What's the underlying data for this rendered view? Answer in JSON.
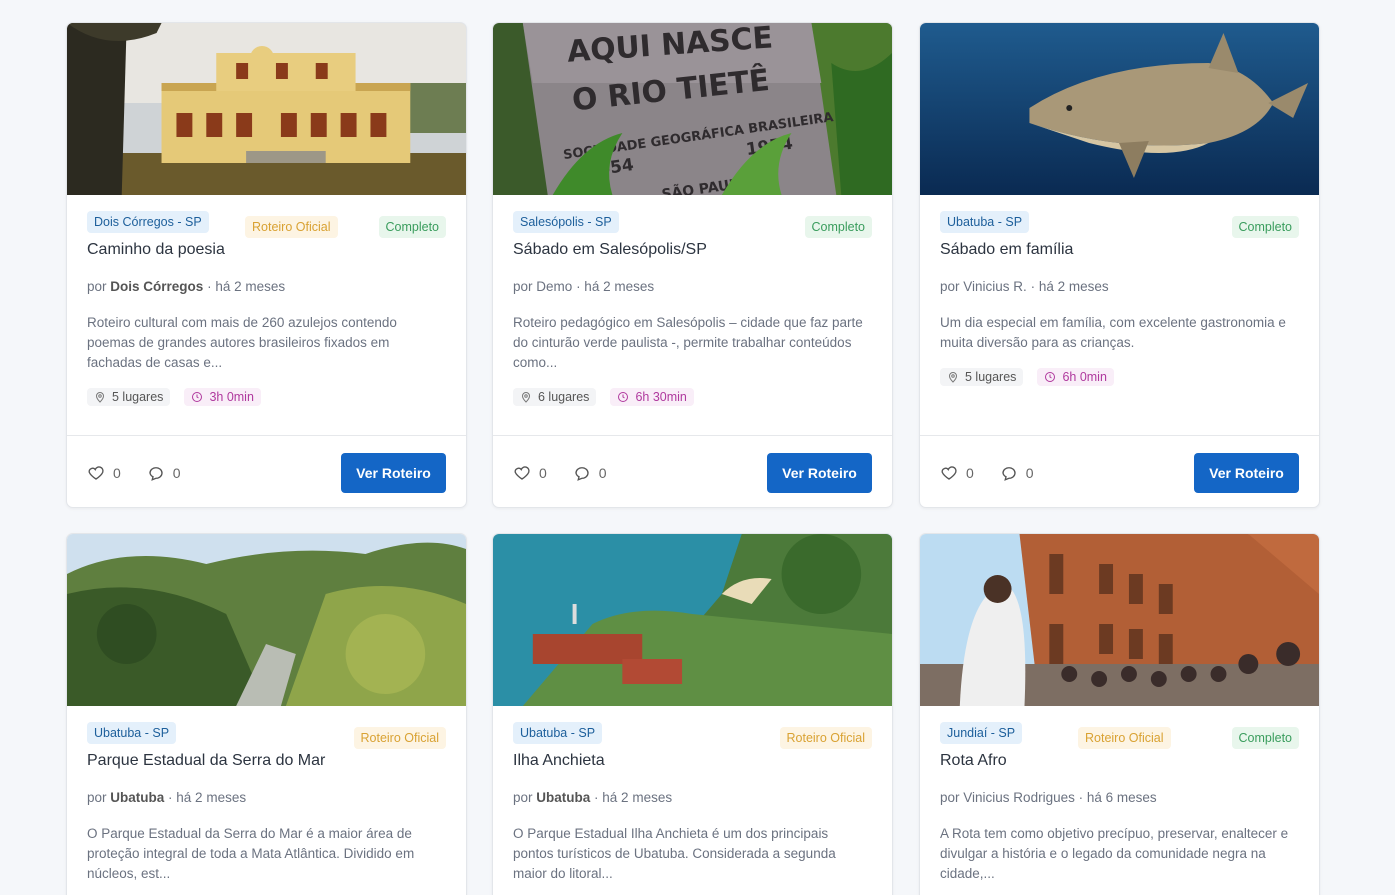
{
  "cards": [
    {
      "location": "Dois Córregos - SP",
      "official": "Roteiro Oficial",
      "status": "Completo",
      "title": "Caminho da poesia",
      "by": "por",
      "author": "Dois Córregos",
      "age": "· há 2 meses",
      "description": "Roteiro cultural com mais de 260 azulejos contendo poemas de grandes autores brasileiros fixados em fachadas de casas e...",
      "places": "5 lugares",
      "duration": "3h 0min",
      "likes": "0",
      "comments": "0",
      "button": "Ver Roteiro"
    },
    {
      "location": "Salesópolis - SP",
      "status": "Completo",
      "title": "Sábado em Salesópolis/SP",
      "by": "por",
      "author": "Demo",
      "age": "· há 2 meses",
      "description": "Roteiro pedagógico em Salesópolis – cidade que faz parte do cinturão verde paulista -, permite trabalhar conteúdos como...",
      "places": "6 lugares",
      "duration": "6h 30min",
      "likes": "0",
      "comments": "0",
      "button": "Ver Roteiro",
      "image_text": [
        "AQUI NASCE",
        "O RIO TIETÊ",
        "SOCIEDADE GEOGRÁFICA BRASILEIRA",
        "1554",
        "1954",
        "SÃO PAULO"
      ]
    },
    {
      "location": "Ubatuba - SP",
      "status": "Completo",
      "title": "Sábado em família",
      "by": "por",
      "author": "Vinicius R.",
      "age": "· há 2 meses",
      "description": "Um dia especial em família, com excelente gastronomia e muita diversão para as crianças.",
      "places": "5 lugares",
      "duration": "6h 0min",
      "likes": "0",
      "comments": "0",
      "button": "Ver Roteiro"
    },
    {
      "location": "Ubatuba - SP",
      "official": "Roteiro Oficial",
      "title": "Parque Estadual da Serra do Mar",
      "by": "por",
      "author": "Ubatuba",
      "age": "· há 2 meses",
      "description": "O Parque Estadual da Serra do Mar é a maior área de proteção integral de toda a Mata Atlântica. Dividido em núcleos, est..."
    },
    {
      "location": "Ubatuba - SP",
      "official": "Roteiro Oficial",
      "title": "Ilha Anchieta",
      "by": "por",
      "author": "Ubatuba",
      "age": "· há 2 meses",
      "description": "O Parque Estadual Ilha Anchieta é um dos principais pontos turísticos de Ubatuba. Considerada a segunda maior do litoral..."
    },
    {
      "location": "Jundiaí - SP",
      "official": "Roteiro Oficial",
      "status": "Completo",
      "title": "Rota Afro",
      "by": "por",
      "author": "Vinicius Rodrigues",
      "age": "· há 6 meses",
      "description": "A Rota tem como objetivo precípuo, preservar, enaltecer e divulgar a história e o legado da comunidade negra na cidade,..."
    }
  ],
  "colors": {
    "primary": "#1466c6",
    "location_badge": "#e4f0fb",
    "official_badge": "#fdf4e3",
    "complete_badge": "#e8f6ec",
    "time_chip": "#f9eef8"
  },
  "icons": [
    "map-pin-icon",
    "clock-icon",
    "heart-icon",
    "comment-icon"
  ]
}
